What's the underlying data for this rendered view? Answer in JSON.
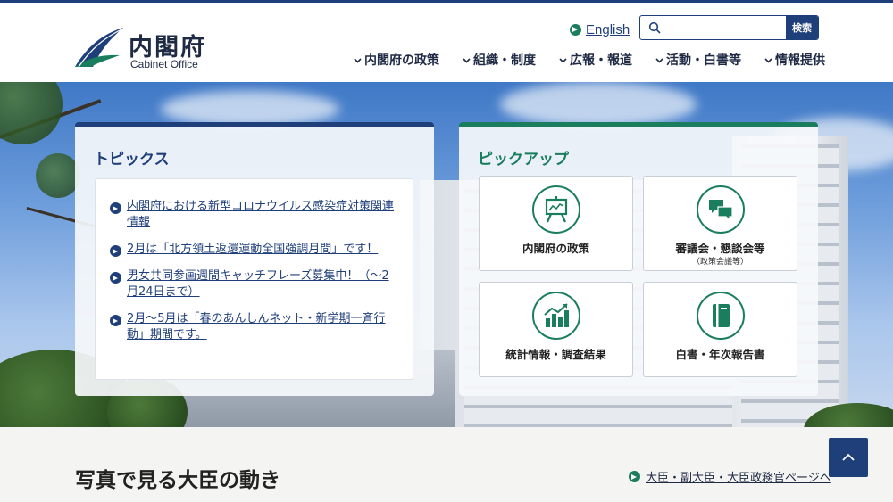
{
  "header": {
    "logo_jp": "内閣府",
    "logo_en": "Cabinet Office",
    "english_link": "English",
    "search": {
      "placeholder": "",
      "button_label": "検索"
    },
    "nav": [
      {
        "label": "内閣府の政策"
      },
      {
        "label": "組織・制度"
      },
      {
        "label": "広報・報道"
      },
      {
        "label": "活動・白書等"
      },
      {
        "label": "情報提供"
      }
    ]
  },
  "topics": {
    "title": "トピックス",
    "items": [
      {
        "text": "内閣府における新型コロナウイルス感染症対策関連情報"
      },
      {
        "text": "2月は「北方領土返還運動全国強調月間」です！"
      },
      {
        "text": "男女共同参画週間キャッチフレーズ募集中！（～2月24日まで）"
      },
      {
        "text": "2月～5月は「春のあんしんネット・新学期一斉行動」期間です。"
      }
    ]
  },
  "pickup": {
    "title": "ピックアップ",
    "tiles": [
      {
        "label": "内閣府の政策",
        "sub": "",
        "icon": "presentation-board-icon"
      },
      {
        "label": "審議会・懇談会等",
        "sub": "（政策会議等）",
        "icon": "speech-bubbles-icon"
      },
      {
        "label": "統計情報・調査結果",
        "sub": "",
        "icon": "bar-chart-icon"
      },
      {
        "label": "白書・年次報告書",
        "sub": "",
        "icon": "book-icon"
      }
    ]
  },
  "bottom": {
    "section_title": "写真で見る大臣の動き",
    "minister_link": "大臣・副大臣・大臣政務官ページへ"
  },
  "colors": {
    "brand_blue": "#1f3f7a",
    "brand_green": "#1a7d5e"
  }
}
